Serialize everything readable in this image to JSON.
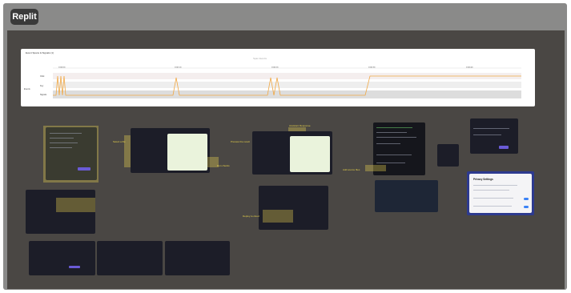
{
  "app": {
    "logo_text": "Replit"
  },
  "chart": {
    "title": "Event Spans & Signals (1)",
    "subtitle": "Span Events",
    "left_label": "Events",
    "timestamps": [
      "0:00:00",
      "0:00:10",
      "0:00:20",
      "0:00:30",
      "0:00:40"
    ],
    "rows": [
      "Click",
      "Key",
      "Signals"
    ]
  },
  "annotations": {
    "a1": "Select a file",
    "a2": "Run checks",
    "a3": "Preview the result",
    "a4": "Assistant Response",
    "a5": "Add source files",
    "a6": "Deploy to cloud",
    "a7": "Open the panel"
  },
  "privacy": {
    "title": "Privacy Settings"
  },
  "chart_data": {
    "type": "line",
    "title": "Event Spans & Signals (1)",
    "x": [
      "0:00:00",
      "0:00:10",
      "0:00:20",
      "0:00:30",
      "0:00:40"
    ],
    "series": [
      {
        "name": "Signals",
        "values": [
          0,
          1,
          0,
          1,
          0
        ]
      }
    ]
  }
}
